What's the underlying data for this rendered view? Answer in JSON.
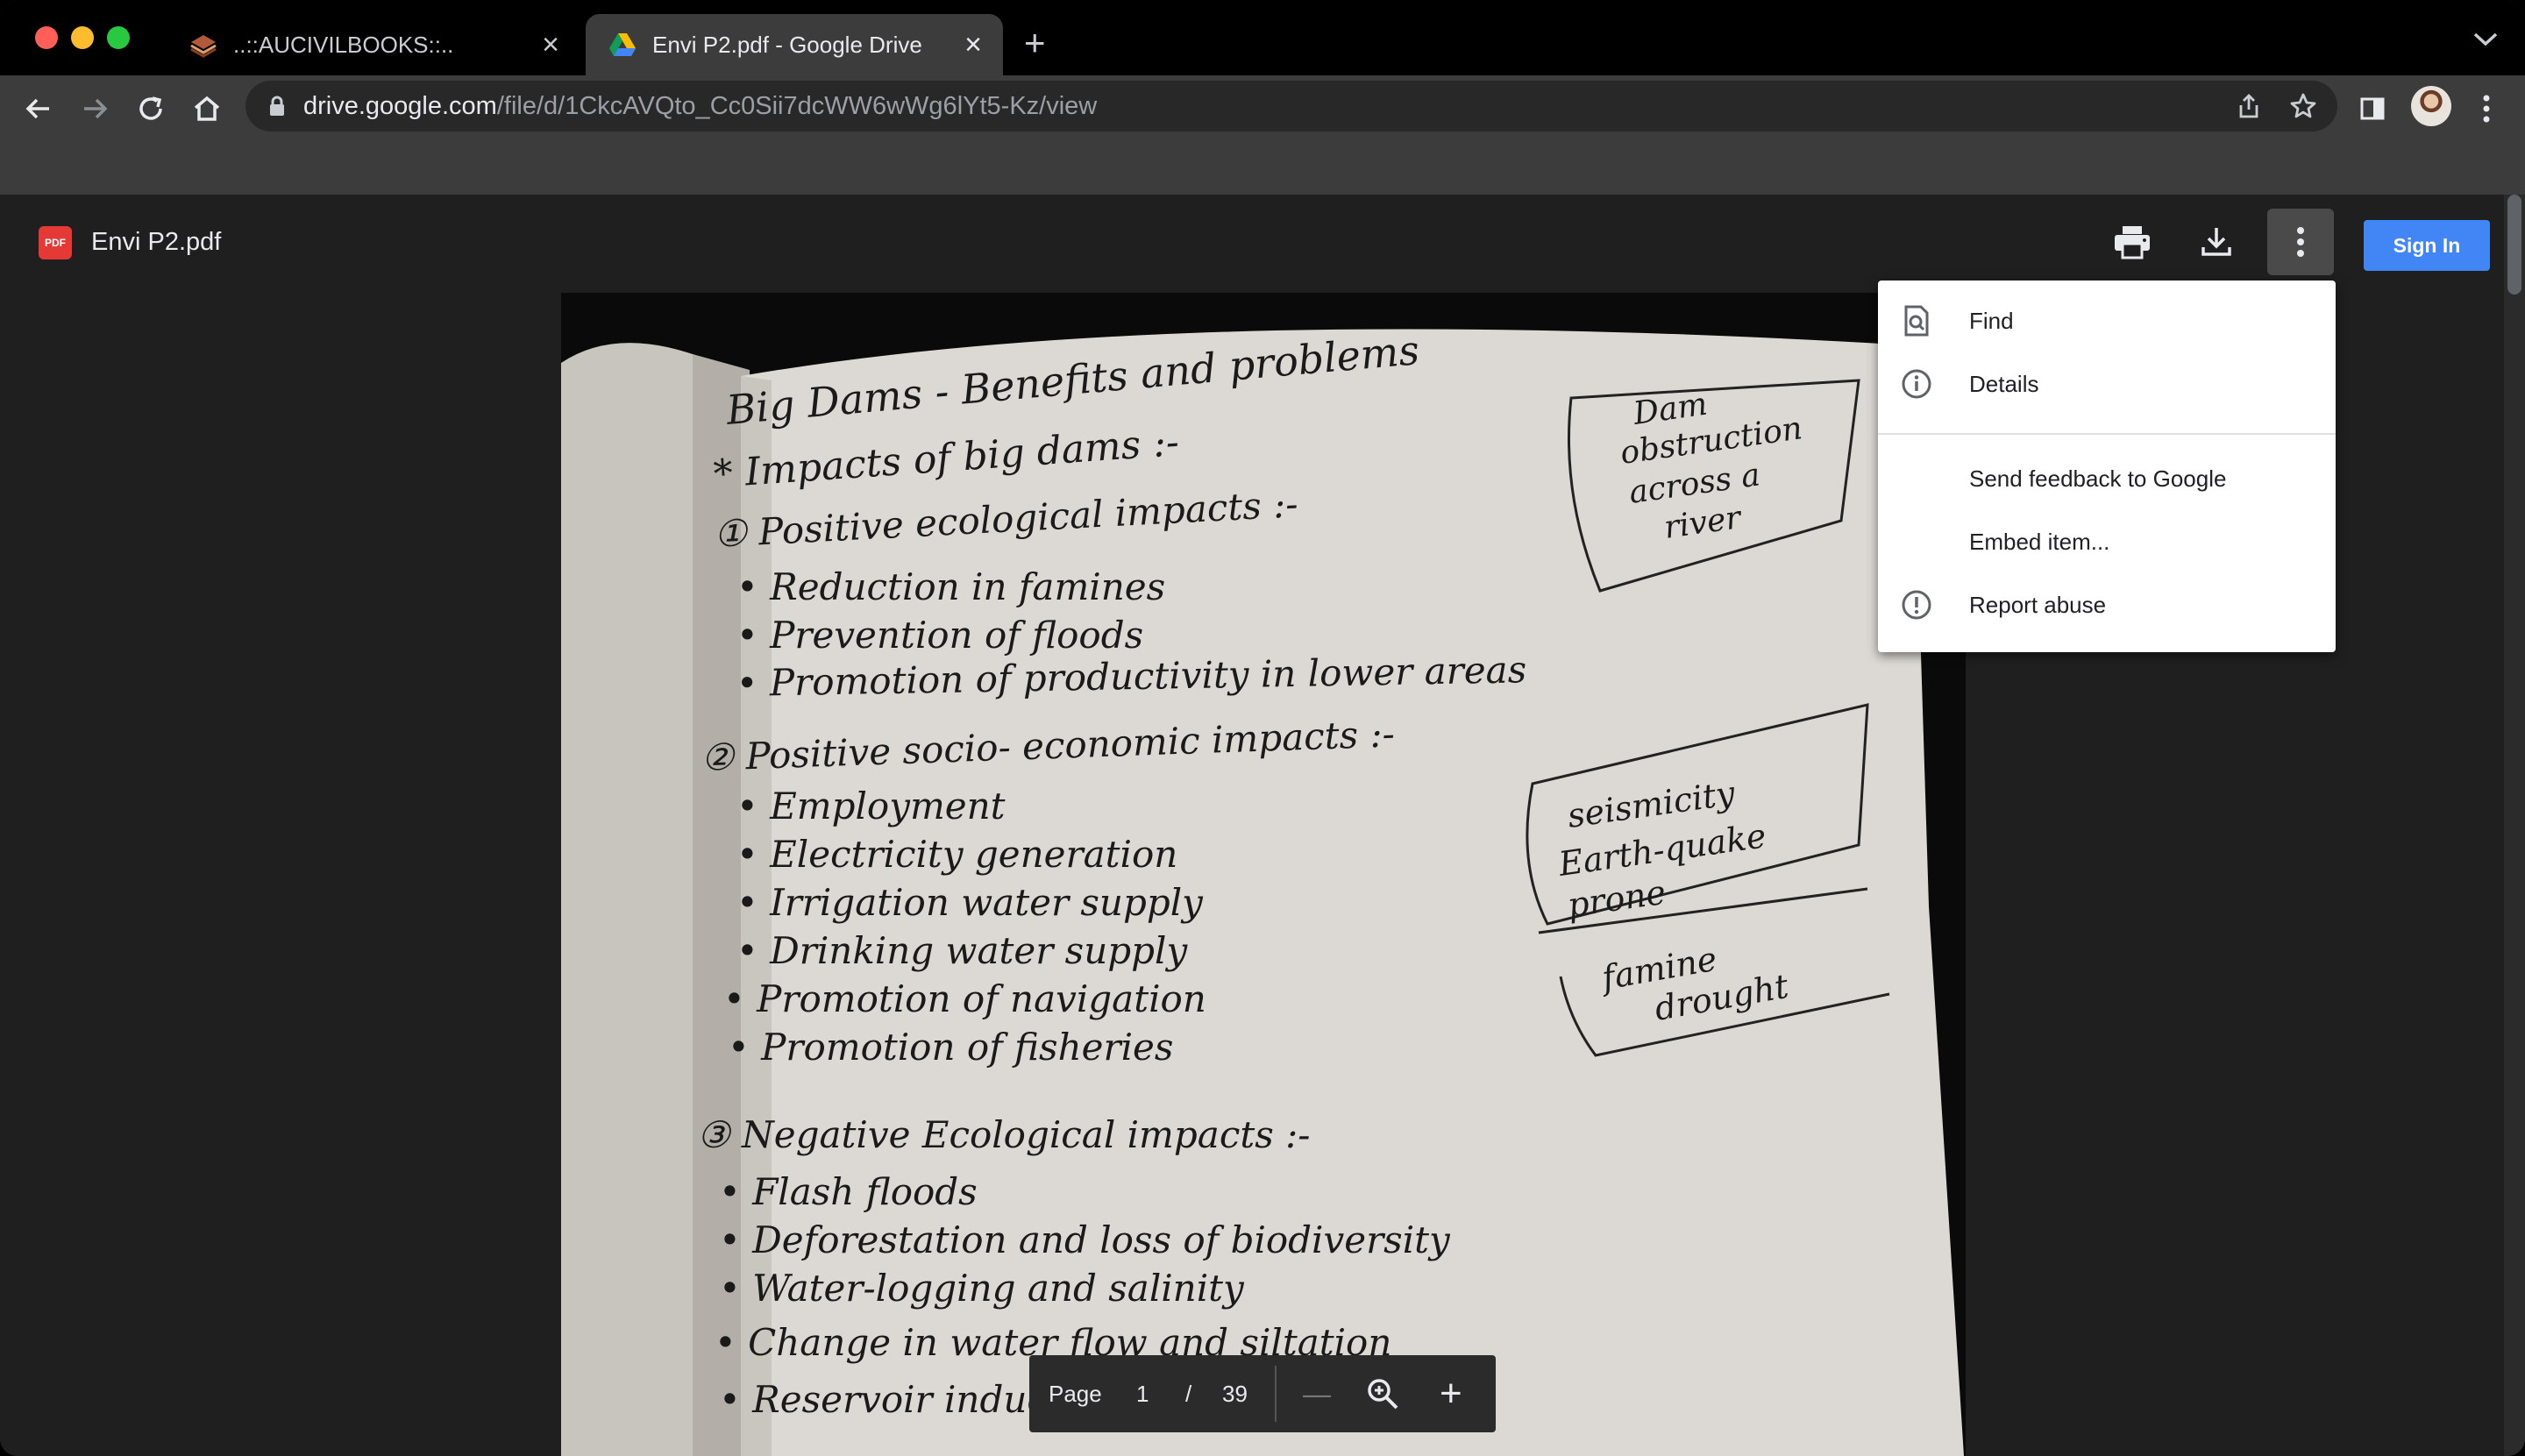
{
  "browser": {
    "tabs": [
      {
        "title": "..::AUCIVILBOOKS::..",
        "close": "×"
      },
      {
        "title": "Envi P2.pdf - Google Drive",
        "close": "×"
      }
    ],
    "new_tab": "+",
    "url": {
      "host": "drive.google.com",
      "path": "/file/d/1CkcAVQto_Cc0Sii7dcWW6wWg6lYt5-Kz/view"
    }
  },
  "viewer": {
    "file_name": "Envi P2.pdf",
    "file_badge": "PDF",
    "sign_in": "Sign In",
    "pager": {
      "label": "Page",
      "current": "1",
      "separator": "/",
      "total": "39",
      "zoom_out": "—",
      "zoom_in": "+"
    }
  },
  "more_menu": {
    "items": [
      {
        "label": "Find",
        "icon": "find-in-page-icon"
      },
      {
        "label": "Details",
        "icon": "info-icon"
      },
      {
        "label": "Send feedback to Google",
        "icon": ""
      },
      {
        "label": "Embed item...",
        "icon": ""
      },
      {
        "label": "Report abuse",
        "icon": "report-icon"
      }
    ]
  },
  "notes": {
    "heading": "Big Dams - Benefits and problems",
    "subheading": "* Impacts of big dams :-",
    "sections": [
      {
        "title": "① Positive ecological impacts :-",
        "items": [
          "• Reduction in famines",
          "• Prevention of floods",
          "• Promotion of productivity in lower areas"
        ]
      },
      {
        "title": "② Positive socio- economic impacts :-",
        "items": [
          "• Employment",
          "• Electricity generation",
          "• Irrigation water supply",
          "• Drinking water supply",
          "• Promotion of navigation",
          "• Promotion of fisheries"
        ]
      },
      {
        "title": "③ Negative Ecological impacts :-",
        "items": [
          "• Flash floods",
          "• Deforestation and loss of biodiversity",
          "• Water-logging and salinity",
          "• Change in water flow and siltation",
          "• Reservoir induced seismicity"
        ]
      }
    ],
    "box1": [
      "Dam",
      "obstruction",
      "across a",
      "river"
    ],
    "box2": [
      "seismicity",
      "Earth-quake",
      "prone"
    ],
    "box3": [
      "famine",
      "drought"
    ]
  },
  "colors": {
    "accent": "#4285f4",
    "pdf_badge": "#e53935",
    "menu_bg": "#ffffff"
  }
}
